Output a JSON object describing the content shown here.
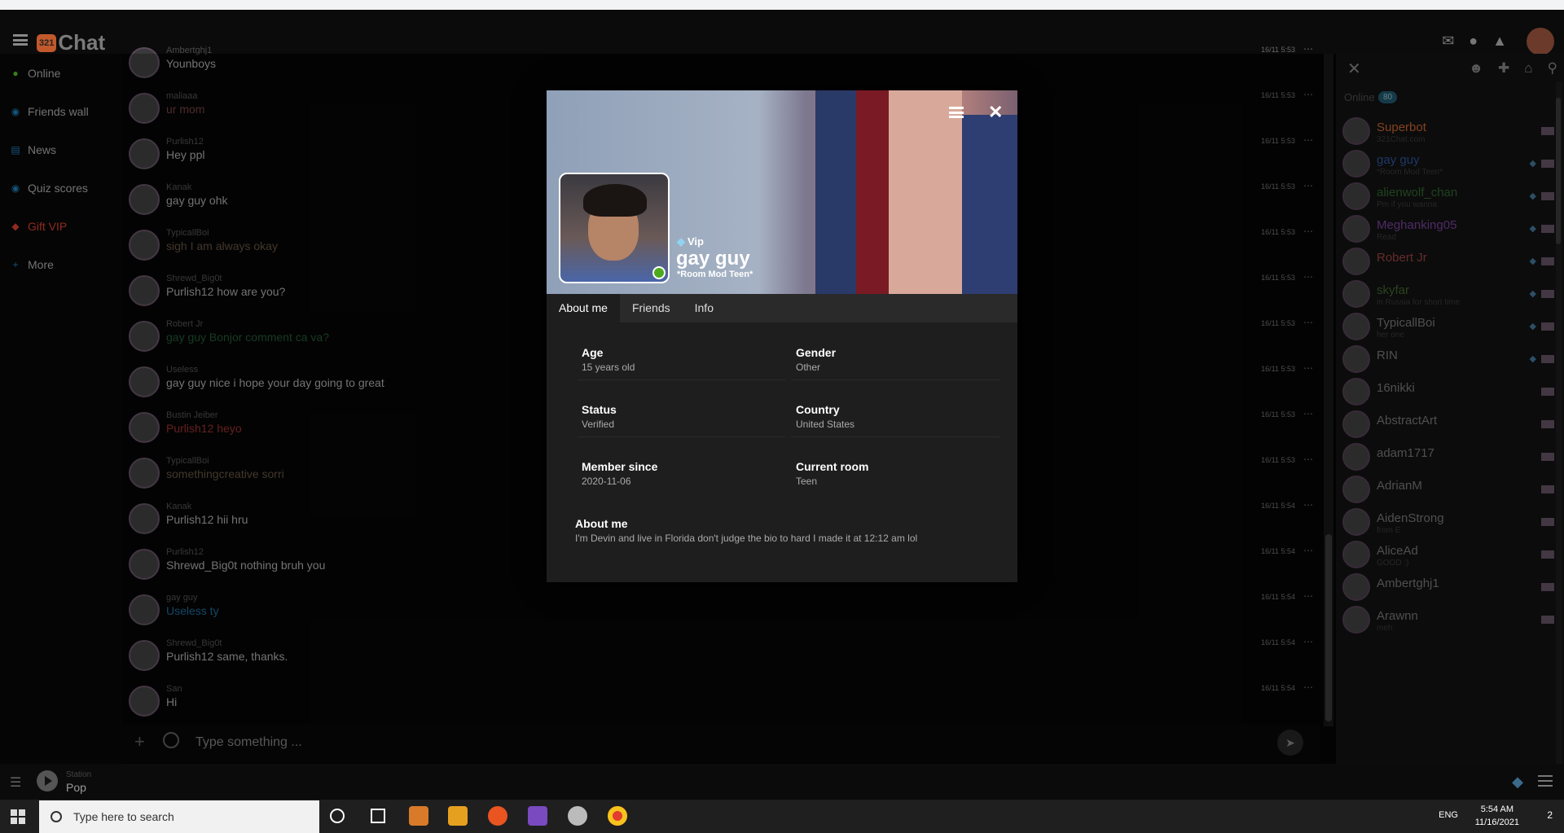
{
  "app": {
    "brand_badge": "321",
    "brand_name": "Chat"
  },
  "leftnav": [
    {
      "icon": "check-circle-icon",
      "label": "Online",
      "color": "#4caa1e"
    },
    {
      "icon": "rss-icon",
      "label": "Friends wall",
      "color": "#1d6fa5"
    },
    {
      "icon": "newspaper-icon",
      "label": "News",
      "color": "#1d6fa5"
    },
    {
      "icon": "quiz-icon",
      "label": "Quiz scores",
      "color": "#1d6fa5"
    },
    {
      "icon": "diamond-icon",
      "label": "Gift VIP",
      "color": "#c0392b"
    },
    {
      "icon": "plus-icon",
      "label": "More",
      "color": "#1d6fa5"
    }
  ],
  "messages": [
    {
      "user": "Ambertghj1",
      "text": "Younboys",
      "time": "16/11 5:53",
      "color": "#9a9a9a"
    },
    {
      "user": "maliaaa",
      "text": "ur mom",
      "time": "16/11 5:53",
      "color": "#6a3a3a"
    },
    {
      "user": "Purlish12",
      "text": "Hey ppl",
      "time": "16/11 5:53",
      "color": "#9a9a9a"
    },
    {
      "user": "Kanak",
      "text": "gay guy ohk",
      "time": "16/11 5:53",
      "color": "#9a9a9a"
    },
    {
      "user": "TypicallBoi",
      "text": "sigh I am always okay",
      "time": "16/11 5:53",
      "color": "#5a4a3a"
    },
    {
      "user": "Shrewd_Big0t",
      "text": "Purlish12 how are you?",
      "time": "16/11 5:53",
      "color": "#9a9a9a"
    },
    {
      "user": "Robert Jr",
      "text": "gay guy Bonjor comment ca va?",
      "time": "16/11 5:53",
      "color": "#1f4f2f"
    },
    {
      "user": "Useless",
      "text": "gay guy nice i hope your day going to great",
      "time": "16/11 5:53",
      "color": "#9a9a9a"
    },
    {
      "user": "Bustin Jeiber",
      "text": "Purlish12 heyo",
      "time": "16/11 5:53",
      "color": "#8a2a2a"
    },
    {
      "user": "TypicallBoi",
      "text": "somethingcreative sorri",
      "time": "16/11 5:53",
      "color": "#5a4a3a"
    },
    {
      "user": "Kanak",
      "text": "Purlish12 hii hru",
      "time": "16/11 5:54",
      "color": "#9a9a9a"
    },
    {
      "user": "Purlish12",
      "text": "Shrewd_Big0t nothing bruh you",
      "time": "16/11 5:54",
      "color": "#9a9a9a"
    },
    {
      "user": "gay guy",
      "text": "Useless ty",
      "time": "16/11 5:54",
      "color": "#1d5f8a"
    },
    {
      "user": "Shrewd_Big0t",
      "text": "Purlish12 same, thanks.",
      "time": "16/11 5:54",
      "color": "#9a9a9a"
    },
    {
      "user": "San",
      "text": "Hi",
      "time": "16/11 5:54",
      "color": "#9a9a9a"
    }
  ],
  "input": {
    "placeholder": "Type something ..."
  },
  "player": {
    "label": "Station",
    "station": "Pop"
  },
  "online": {
    "label": "Online",
    "count": "80"
  },
  "users": [
    {
      "name": "Superbot",
      "mood": "321Chat.com",
      "color": "#b05a2a"
    },
    {
      "name": "gay guy",
      "mood": "*Room Mod Teen*",
      "color": "#2a4a8a"
    },
    {
      "name": "alienwolf_chan",
      "mood": "Pm if you wanna",
      "color": "#2a5a2a"
    },
    {
      "name": "Meghanking05",
      "mood": "Read",
      "color": "#6a3a8a"
    },
    {
      "name": "Robert Jr",
      "mood": "",
      "color": "#8a3a3a"
    },
    {
      "name": "skyfar",
      "mood": "in Russia for short time",
      "color": "#3a5a2a"
    },
    {
      "name": "TypicallBoi",
      "mood": "her one",
      "color": "#6a6a6a"
    },
    {
      "name": "RIN",
      "mood": "",
      "color": "#6a6a6a"
    },
    {
      "name": "16nikki",
      "mood": "",
      "color": "#6a6a6a"
    },
    {
      "name": "AbstractArt",
      "mood": "",
      "color": "#6a6a6a"
    },
    {
      "name": "adam1717",
      "mood": "",
      "color": "#6a6a6a"
    },
    {
      "name": "AdrianM",
      "mood": "",
      "color": "#6a6a6a"
    },
    {
      "name": "AidenStrong",
      "mood": "from E",
      "color": "#6a6a6a"
    },
    {
      "name": "AliceAd",
      "mood": "GOOD :)",
      "color": "#6a6a6a"
    },
    {
      "name": "Ambertghj1",
      "mood": "",
      "color": "#6a6a6a"
    },
    {
      "name": "Arawnn",
      "mood": "meh",
      "color": "#6a6a6a"
    }
  ],
  "profile": {
    "vip": "Vip",
    "name": "gay guy",
    "rank": "*Room Mod Teen*",
    "tabs": [
      "About me",
      "Friends",
      "Info"
    ],
    "fields": [
      {
        "label": "Age",
        "value": "15 years old"
      },
      {
        "label": "Gender",
        "value": "Other"
      },
      {
        "label": "Status",
        "value": "Verified"
      },
      {
        "label": "Country",
        "value": "United States"
      },
      {
        "label": "Member since",
        "value": "2020-11-06"
      },
      {
        "label": "Current room",
        "value": "Teen"
      }
    ],
    "about_label": "About me",
    "about_value": "I'm Devin and live in Florida don't judge the bio to hard I made it at 12:12 am lol"
  },
  "taskbar": {
    "search": "Type here to search",
    "lang": "ENG",
    "time": "5:54 AM",
    "date": "11/16/2021",
    "notif": "2"
  }
}
